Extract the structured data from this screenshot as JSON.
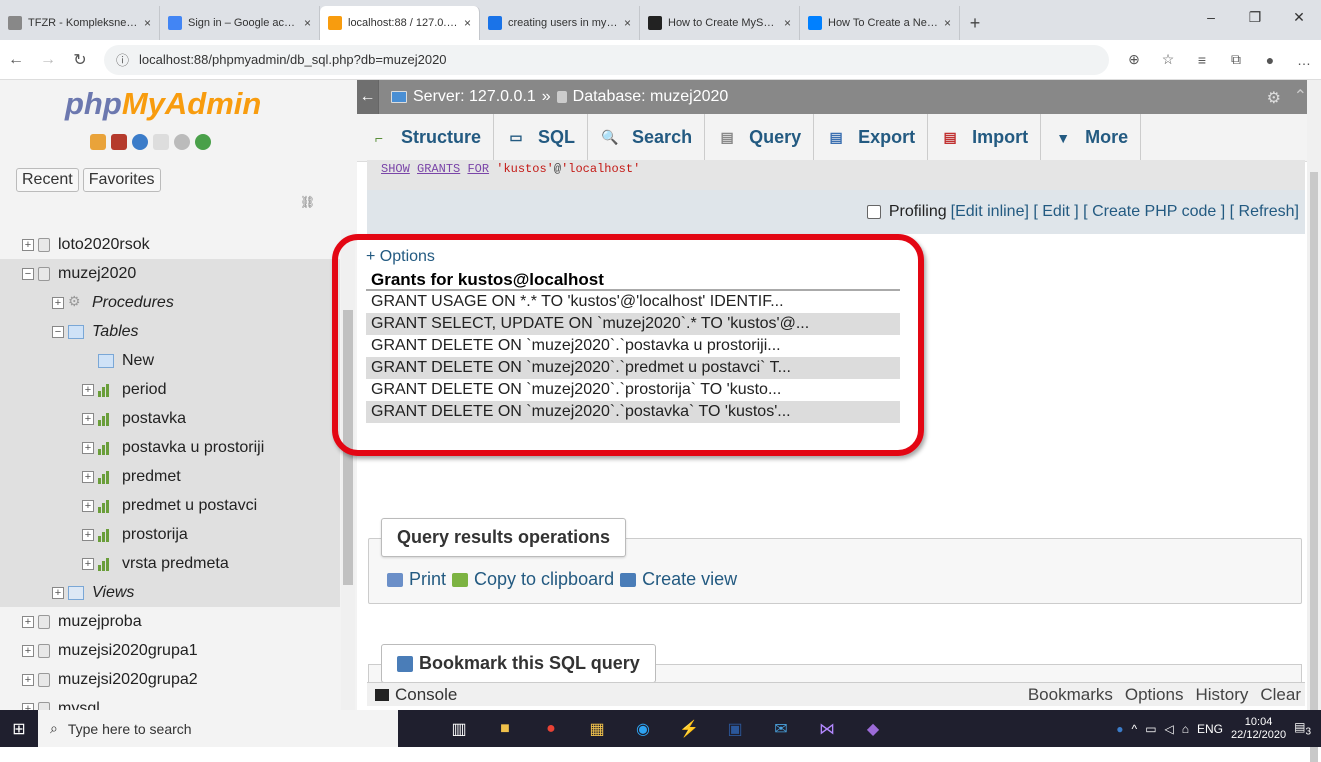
{
  "browser": {
    "tabs": [
      {
        "title": "TFZR - Kompleksne baz",
        "fav_color": "#888"
      },
      {
        "title": "Sign in – Google accou",
        "fav_color": "#4285f4"
      },
      {
        "title": "localhost:88 / 127.0.0.1",
        "fav_color": "#f89c0e"
      },
      {
        "title": "creating users in mysql",
        "fav_color": "#1a73e8"
      },
      {
        "title": "How to Create MySQL",
        "fav_color": "#222"
      },
      {
        "title": "How To Create a New U",
        "fav_color": "#0080ff"
      }
    ],
    "close_glyph": "×",
    "newtab_glyph": "+",
    "url": "localhost:88/phpmyadmin/db_sql.php?db=muzej2020"
  },
  "sidebar": {
    "logo_php": "php",
    "logo_myadmin": "MyAdmin",
    "recent": "Recent",
    "favorites": "Favorites",
    "tree": [
      {
        "label": "loto2020rsok",
        "kind": "db",
        "indent": 0,
        "italic": false,
        "sel": false
      },
      {
        "label": "muzej2020",
        "kind": "db",
        "indent": 0,
        "italic": false,
        "sel": true
      },
      {
        "label": "Procedures",
        "kind": "proc",
        "indent": 1,
        "italic": true,
        "sel": true
      },
      {
        "label": "Tables",
        "kind": "tables",
        "indent": 1,
        "italic": true,
        "sel": true
      },
      {
        "label": "New",
        "kind": "new",
        "indent": 2,
        "italic": false,
        "sel": true
      },
      {
        "label": "period",
        "kind": "table",
        "indent": 2,
        "italic": false,
        "sel": true
      },
      {
        "label": "postavka",
        "kind": "table",
        "indent": 2,
        "italic": false,
        "sel": true
      },
      {
        "label": "postavka u prostoriji",
        "kind": "table",
        "indent": 2,
        "italic": false,
        "sel": true
      },
      {
        "label": "predmet",
        "kind": "table",
        "indent": 2,
        "italic": false,
        "sel": true
      },
      {
        "label": "predmet u postavci",
        "kind": "table",
        "indent": 2,
        "italic": false,
        "sel": true
      },
      {
        "label": "prostorija",
        "kind": "table",
        "indent": 2,
        "italic": false,
        "sel": true
      },
      {
        "label": "vrsta predmeta",
        "kind": "table",
        "indent": 2,
        "italic": false,
        "sel": true
      },
      {
        "label": "Views",
        "kind": "views",
        "indent": 1,
        "italic": true,
        "sel": true
      },
      {
        "label": "muzejproba",
        "kind": "db",
        "indent": 0,
        "italic": false,
        "sel": false
      },
      {
        "label": "muzejsi2020grupa1",
        "kind": "db",
        "indent": 0,
        "italic": false,
        "sel": false
      },
      {
        "label": "muzejsi2020grupa2",
        "kind": "db",
        "indent": 0,
        "italic": false,
        "sel": false
      },
      {
        "label": "mysql",
        "kind": "db",
        "indent": 0,
        "italic": false,
        "sel": false
      }
    ]
  },
  "topbar": {
    "server": "Server: 127.0.0.1",
    "sep": "»",
    "database": "Database: muzej2020"
  },
  "menu": [
    {
      "label": "Structure",
      "icon": "structure-icon",
      "glyph": "⌐",
      "color": "#5a8f3a"
    },
    {
      "label": "SQL",
      "icon": "sql-icon",
      "glyph": "▭",
      "color": "#235a81"
    },
    {
      "label": "Search",
      "icon": "search-icon",
      "glyph": "🔍",
      "color": "#235a81"
    },
    {
      "label": "Query",
      "icon": "query-icon",
      "glyph": "▤",
      "color": "#888"
    },
    {
      "label": "Export",
      "icon": "export-icon",
      "glyph": "▤",
      "color": "#3a6fb0"
    },
    {
      "label": "Import",
      "icon": "import-icon",
      "glyph": "▤",
      "color": "#c03030"
    },
    {
      "label": "More",
      "icon": "chevron-down-icon",
      "glyph": "▼",
      "color": "#235a81"
    }
  ],
  "sql": {
    "kw1": "SHOW",
    "kw2": "GRANTS",
    "kw3": "FOR",
    "user": "'kustos'",
    "at": "@",
    "host": "'localhost'"
  },
  "profiling": {
    "label": "Profiling",
    "links": [
      "Edit inline",
      "Edit",
      "Create PHP code",
      "Refresh"
    ]
  },
  "results": {
    "options": "+ Options",
    "header": "Grants for kustos@localhost",
    "rows": [
      "GRANT USAGE ON *.* TO 'kustos'@'localhost' IDENTIF...",
      "GRANT SELECT, UPDATE ON `muzej2020`.* TO 'kustos'@...",
      "GRANT DELETE ON `muzej2020`.`postavka u prostoriji...",
      "GRANT DELETE ON `muzej2020`.`predmet u postavci` T...",
      "GRANT DELETE ON `muzej2020`.`prostorija` TO 'kusto...",
      "GRANT DELETE ON `muzej2020`.`postavka` TO 'kustos'..."
    ]
  },
  "qro": {
    "title": "Query results operations",
    "print": "Print",
    "copy": "Copy to clipboard",
    "view": "Create view"
  },
  "bookmark": {
    "title": "Bookmark this SQL query"
  },
  "console": {
    "label": "Console",
    "links": [
      "Bookmarks",
      "Options",
      "History",
      "Clear"
    ]
  },
  "taskbar": {
    "search_placeholder": "Type here to search",
    "lang": "ENG",
    "time": "10:04",
    "date": "22/12/2020",
    "notif": "3"
  }
}
